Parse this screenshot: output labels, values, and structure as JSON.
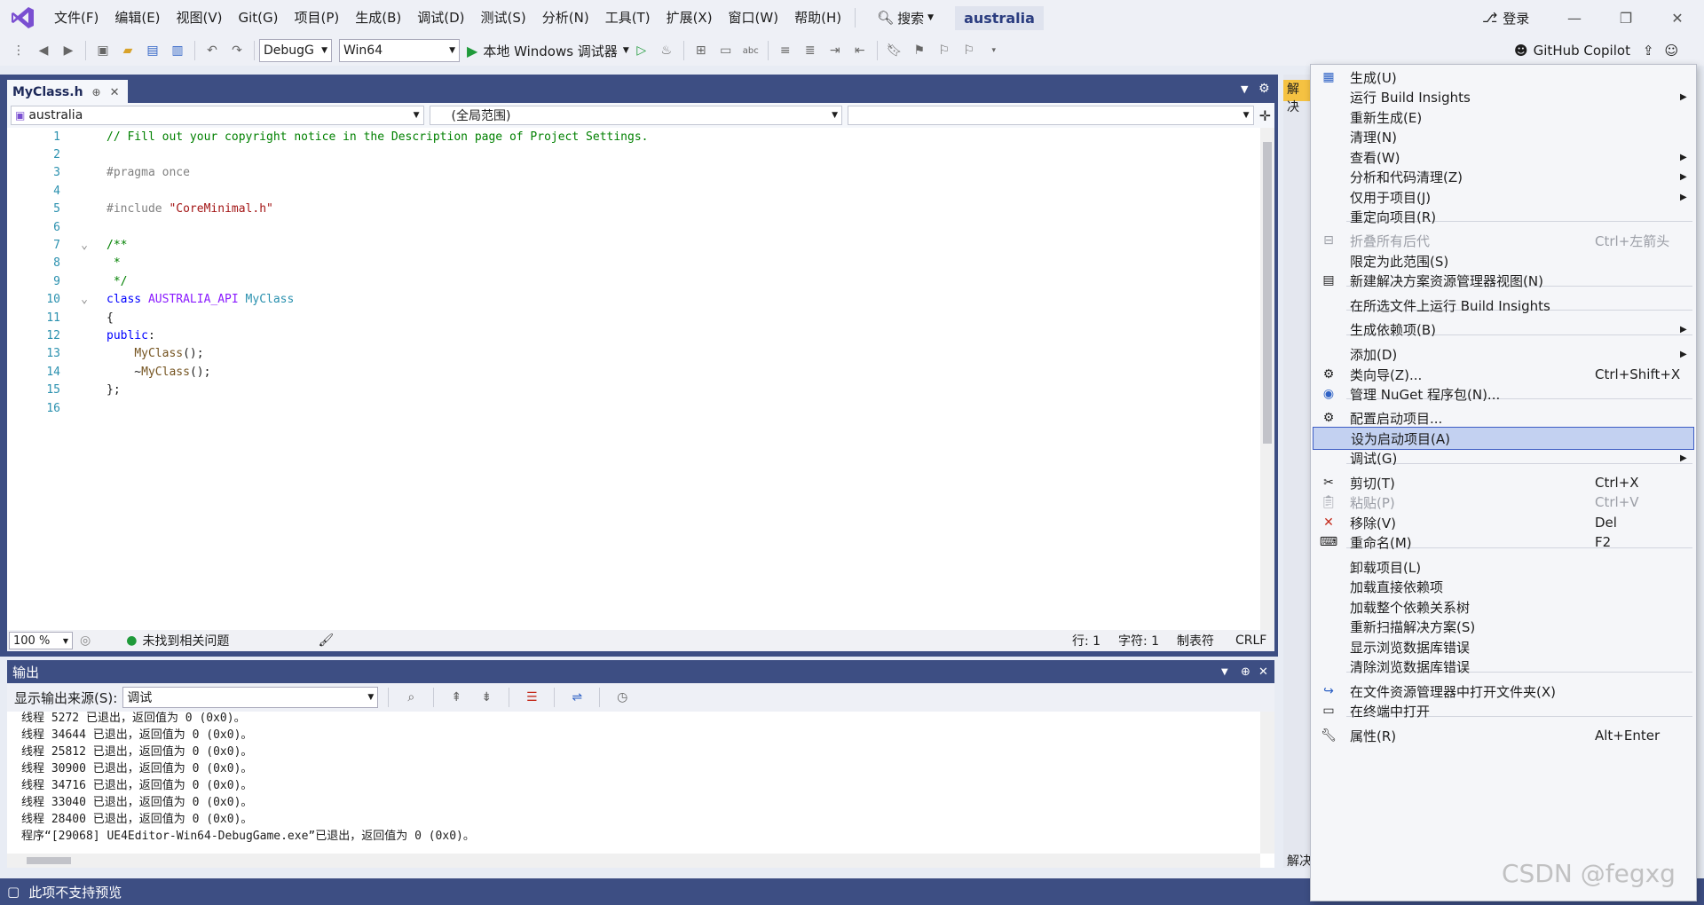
{
  "menu": [
    "文件(F)",
    "编辑(E)",
    "视图(V)",
    "Git(G)",
    "项目(P)",
    "生成(B)",
    "调试(D)",
    "测试(S)",
    "分析(N)",
    "工具(T)",
    "扩展(X)",
    "窗口(W)",
    "帮助(H)"
  ],
  "search_label": "搜索",
  "solution_name": "australia",
  "login_label": "登录",
  "toolbar": {
    "config": "DebugG",
    "platform": "Win64",
    "run_label": "本地 Windows 调试器",
    "copilot": "GitHub Copilot"
  },
  "tab": {
    "title": "MyClass.h"
  },
  "nav": {
    "project": "australia",
    "scope": "(全局范围)",
    "member": ""
  },
  "code_lines": [
    {
      "n": "1",
      "text": "// Fill out your copyright notice in the Description page of Project Settings."
    },
    {
      "n": "2",
      "text": ""
    },
    {
      "n": "3",
      "text": "#pragma once"
    },
    {
      "n": "4",
      "text": ""
    },
    {
      "n": "5",
      "text": "#include \"CoreMinimal.h\""
    },
    {
      "n": "6",
      "text": ""
    },
    {
      "n": "7",
      "text": "/**"
    },
    {
      "n": "8",
      "text": " *"
    },
    {
      "n": "9",
      "text": " */"
    },
    {
      "n": "10",
      "text": "class AUSTRALIA_API MyClass"
    },
    {
      "n": "11",
      "text": "{"
    },
    {
      "n": "12",
      "text": "public:"
    },
    {
      "n": "13",
      "text": "    MyClass();"
    },
    {
      "n": "14",
      "text": "    ~MyClass();"
    },
    {
      "n": "15",
      "text": "};"
    },
    {
      "n": "16",
      "text": ""
    }
  ],
  "editor_status": {
    "zoom": "100 %",
    "issues": "未找到相关问题",
    "line": "行: 1",
    "col": "字符: 1",
    "tabs": "制表符",
    "eol": "CRLF"
  },
  "output": {
    "title": "输出",
    "source_label": "显示输出来源(S):",
    "source_value": "调试",
    "lines": [
      "线程 5272 已退出，返回值为 0 (0x0)。",
      "线程 34644 已退出，返回值为 0 (0x0)。",
      "线程 25812 已退出，返回值为 0 (0x0)。",
      "线程 30900 已退出，返回值为 0 (0x0)。",
      "线程 34716 已退出，返回值为 0 (0x0)。",
      "线程 33040 已退出，返回值为 0 (0x0)。",
      "线程 28400 已退出，返回值为 0 (0x0)。",
      "程序“[29068] UE4Editor-Win64-DebugGame.exe”已退出，返回值为 0 (0x0)。"
    ]
  },
  "right_dock": {
    "tab": "解决",
    "bottom": "解决"
  },
  "status_bar": {
    "text": "此项不支持预览"
  },
  "context_menu": [
    {
      "label": "生成(U)",
      "icon": "build-icon"
    },
    {
      "label": "运行 Build Insights",
      "submenu": true
    },
    {
      "label": "重新生成(E)"
    },
    {
      "label": "清理(N)"
    },
    {
      "label": "查看(W)",
      "submenu": true
    },
    {
      "label": "分析和代码清理(Z)",
      "submenu": true
    },
    {
      "label": "仅用于项目(J)",
      "submenu": true
    },
    {
      "label": "重定向项目(R)"
    },
    {
      "label": "折叠所有后代",
      "shortcut": "Ctrl+左箭头",
      "disabled": true,
      "icon": "collapse-icon"
    },
    {
      "label": "限定为此范围(S)"
    },
    {
      "label": "新建解决方案资源管理器视图(N)",
      "icon": "new-view-icon"
    },
    {
      "label": "在所选文件上运行 Build Insights"
    },
    {
      "label": "生成依赖项(B)",
      "submenu": true
    },
    {
      "label": "添加(D)",
      "submenu": true
    },
    {
      "label": "类向导(Z)...",
      "shortcut": "Ctrl+Shift+X",
      "icon": "class-wizard-icon"
    },
    {
      "label": "管理 NuGet 程序包(N)...",
      "icon": "nuget-icon"
    },
    {
      "label": "配置启动项目...",
      "icon": "gear-icon"
    },
    {
      "label": "设为启动项目(A)",
      "selected": true
    },
    {
      "label": "调试(G)",
      "submenu": true
    },
    {
      "label": "剪切(T)",
      "shortcut": "Ctrl+X",
      "icon": "scissors-icon"
    },
    {
      "label": "粘贴(P)",
      "shortcut": "Ctrl+V",
      "disabled": true,
      "icon": "paste-icon"
    },
    {
      "label": "移除(V)",
      "shortcut": "Del",
      "icon": "remove-icon"
    },
    {
      "label": "重命名(M)",
      "shortcut": "F2",
      "icon": "rename-icon"
    },
    {
      "label": "卸载项目(L)"
    },
    {
      "label": "加载直接依赖项"
    },
    {
      "label": "加载整个依赖关系树"
    },
    {
      "label": "重新扫描解决方案(S)"
    },
    {
      "label": "显示浏览数据库错误"
    },
    {
      "label": "清除浏览数据库错误"
    },
    {
      "label": "在文件资源管理器中打开文件夹(X)",
      "icon": "open-folder-icon"
    },
    {
      "label": "在终端中打开",
      "icon": "terminal-icon"
    },
    {
      "label": "属性(R)",
      "shortcut": "Alt+Enter",
      "icon": "wrench-icon"
    }
  ],
  "watermark": "CSDN @fegxg",
  "colors": {
    "accent": "#3d4e83",
    "selection": "#c3d1f1",
    "vs_purple": "#7a4fd1"
  }
}
